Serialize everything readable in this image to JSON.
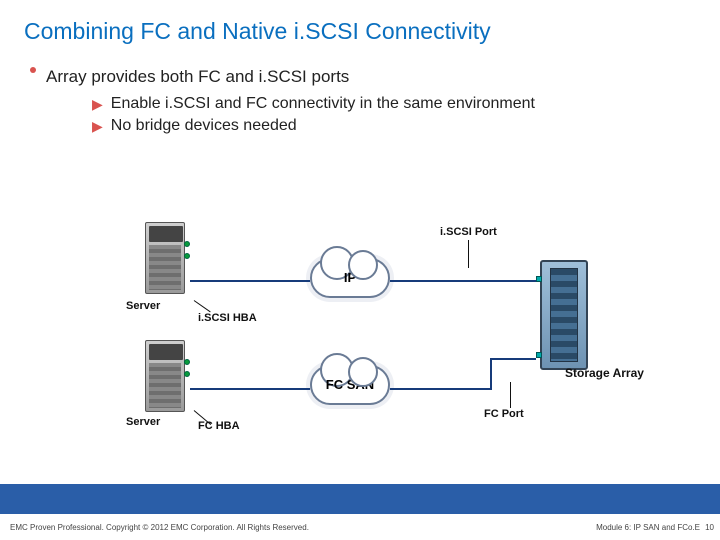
{
  "title": "Combining FC and Native i.SCSI Connectivity",
  "bullet_main": "Array provides both FC and i.SCSI ports",
  "sub_bullets": {
    "a": "Enable i.SCSI and FC connectivity in the same environment",
    "b": "No bridge devices needed"
  },
  "diagram": {
    "server1_label": "Server",
    "server2_label": "Server",
    "iscsi_hba": "i.SCSI HBA",
    "fc_hba": "FC HBA",
    "ip_cloud": "IP",
    "fc_cloud": "FC SAN",
    "iscsi_port": "i.SCSI Port",
    "fc_port": "FC Port",
    "storage_array": "Storage Array"
  },
  "footer": {
    "copyright": "EMC Proven Professional. Copyright © 2012 EMC Corporation. All Rights Reserved.",
    "module": "Module 6: IP SAN and FCo.E",
    "page": "10"
  }
}
